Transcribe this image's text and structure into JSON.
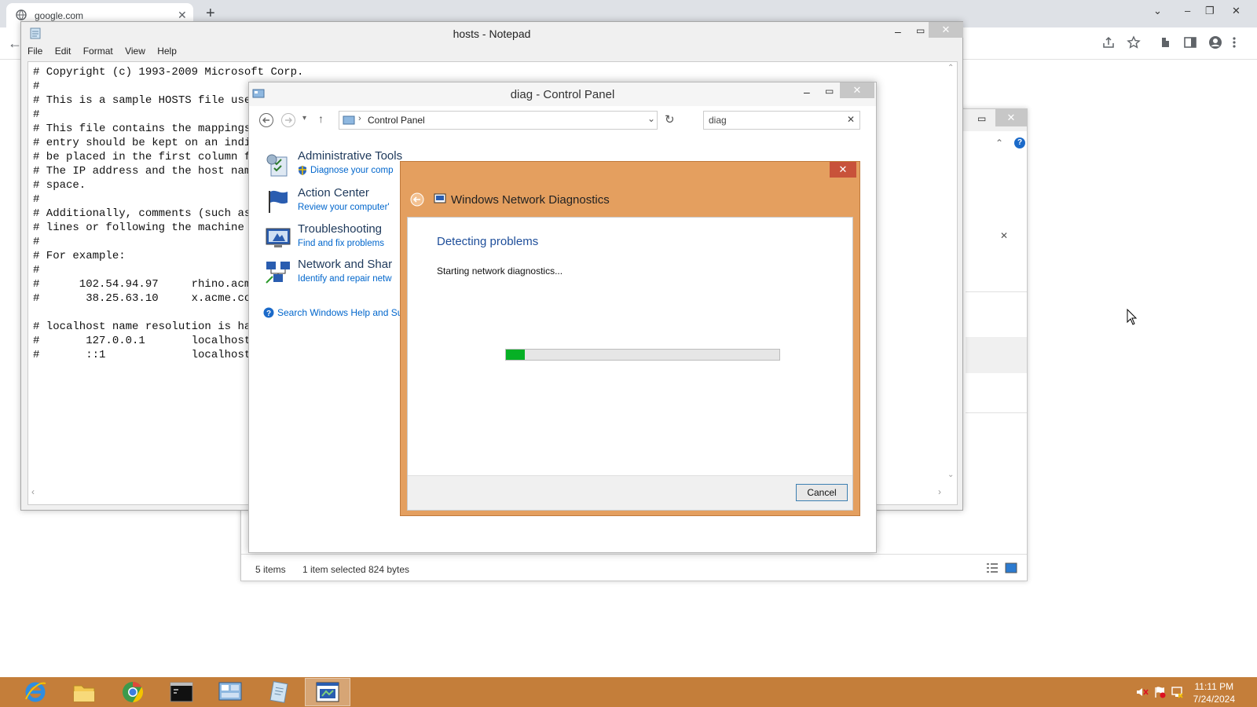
{
  "chrome": {
    "tab_title": "google.com",
    "new_tab": "+",
    "back": "←"
  },
  "explorer": {
    "status_items": "5 items",
    "status_selected": "1 item selected",
    "status_size": "824 bytes"
  },
  "notepad": {
    "title": "hosts - Notepad",
    "menu": [
      "File",
      "Edit",
      "Format",
      "View",
      "Help"
    ],
    "content": "# Copyright (c) 1993-2009 Microsoft Corp.\n#\n# This is a sample HOSTS file used\n#\n# This file contains the mappings o\n# entry should be kept on an indivi\n# be placed in the first column fol\n# The IP address and the host name\n# space.\n#\n# Additionally, comments (such as t\n# lines or following the machine na\n#\n# For example:\n#\n#      102.54.94.97     rhino.acme\n#       38.25.63.10     x.acme.com\n\n# localhost name resolution is hand\n#       127.0.0.1       localhost\n#       ::1             localhost"
  },
  "control_panel": {
    "title": "diag - Control Panel",
    "breadcrumb": "Control Panel",
    "search_value": "diag",
    "items": [
      {
        "title": "Administrative Tools",
        "subtitle": "Diagnose your comp",
        "icon": "admin-tools-icon"
      },
      {
        "title": "Action Center",
        "subtitle": "Review your computer'",
        "icon": "action-center-flag-icon"
      },
      {
        "title": "Troubleshooting",
        "subtitle": "Find and fix problems",
        "icon": "troubleshooting-icon"
      },
      {
        "title": "Network and Shar",
        "subtitle": "Identify and repair netw",
        "icon": "network-icon"
      }
    ],
    "help_link": "Search Windows Help and Su"
  },
  "diag": {
    "title": "Windows Network Diagnostics",
    "heading": "Detecting problems",
    "status": "Starting network diagnostics...",
    "progress": 0.07,
    "cancel_label": "Cancel"
  },
  "taskbar": {
    "apps": [
      "internet-explorer-icon",
      "file-explorer-icon",
      "chrome-icon",
      "command-prompt-icon",
      "control-panel-icon",
      "notepad-icon",
      "network-diagnostics-icon"
    ],
    "active": "network-diagnostics-icon",
    "time": "11:11 PM",
    "date": "7/24/2024"
  },
  "colors": {
    "diag_frame": "#e49f5f",
    "taskbar": "#c47e3a",
    "progress": "#06b025",
    "link": "#0066cc",
    "heading_blue": "#1e395b"
  }
}
